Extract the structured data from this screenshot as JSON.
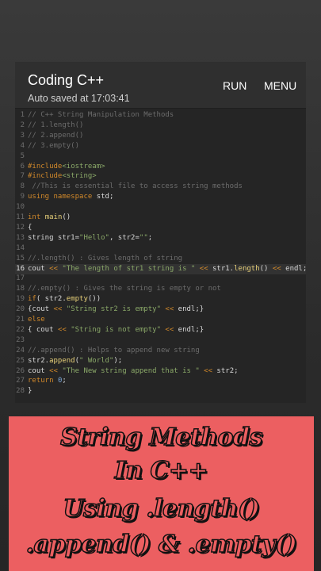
{
  "app": {
    "title": "Coding C++",
    "autosave": "Auto saved at 17:03:41",
    "run_label": "RUN",
    "menu_label": "MENU"
  },
  "editor": {
    "active_line": 16,
    "lines": [
      {
        "n": "1",
        "t": [
          [
            "cm",
            "// C++ String Manipulation Methods"
          ]
        ]
      },
      {
        "n": "2",
        "t": [
          [
            "cm",
            "// 1.length()"
          ]
        ]
      },
      {
        "n": "3",
        "t": [
          [
            "cm",
            "// 2.append()"
          ]
        ]
      },
      {
        "n": "4",
        "t": [
          [
            "cm",
            "// 3.empty()"
          ]
        ]
      },
      {
        "n": "5",
        "t": []
      },
      {
        "n": "6",
        "t": [
          [
            "pp",
            "#include"
          ],
          [
            "st",
            "<iostream>"
          ]
        ]
      },
      {
        "n": "7",
        "t": [
          [
            "pp",
            "#include"
          ],
          [
            "st",
            "<string>"
          ]
        ]
      },
      {
        "n": "8",
        "t": [
          [
            "cm",
            " //This is essential file to access string methods"
          ]
        ]
      },
      {
        "n": "9",
        "t": [
          [
            "kw",
            "using namespace"
          ],
          [
            "tx",
            " std;"
          ]
        ]
      },
      {
        "n": "10",
        "t": []
      },
      {
        "n": "11",
        "t": [
          [
            "kw",
            "int"
          ],
          [
            "tx",
            " "
          ],
          [
            "fn",
            "main"
          ],
          [
            "tx",
            "()"
          ]
        ]
      },
      {
        "n": "12",
        "t": [
          [
            "tx",
            "{"
          ]
        ]
      },
      {
        "n": "13",
        "t": [
          [
            "tx",
            "string str1="
          ],
          [
            "st",
            "\"Hello\""
          ],
          [
            "tx",
            ", str2="
          ],
          [
            "st",
            "\"\""
          ],
          [
            "tx",
            ";"
          ]
        ]
      },
      {
        "n": "14",
        "t": []
      },
      {
        "n": "15",
        "t": [
          [
            "cm",
            "//.length() : Gives length of string"
          ]
        ]
      },
      {
        "n": "16",
        "t": [
          [
            "tx",
            "cout "
          ],
          [
            "op",
            "<<"
          ],
          [
            "st",
            " \"The length of str1 string is \" "
          ],
          [
            "op",
            "<<"
          ],
          [
            "tx",
            " str1."
          ],
          [
            "fn",
            "length"
          ],
          [
            "tx",
            "() "
          ],
          [
            "op",
            "<<"
          ],
          [
            "tx",
            " endl;"
          ]
        ]
      },
      {
        "n": "17",
        "t": []
      },
      {
        "n": "18",
        "t": [
          [
            "cm",
            "//.empty() : Gives the string is empty or not"
          ]
        ]
      },
      {
        "n": "19",
        "t": [
          [
            "kw",
            "if"
          ],
          [
            "tx",
            "( str2."
          ],
          [
            "fn",
            "empty"
          ],
          [
            "tx",
            "())"
          ]
        ]
      },
      {
        "n": "20",
        "t": [
          [
            "tx",
            "{cout "
          ],
          [
            "op",
            "<<"
          ],
          [
            "st",
            " \"String str2 is empty\" "
          ],
          [
            "op",
            "<<"
          ],
          [
            "tx",
            " endl;}"
          ]
        ]
      },
      {
        "n": "21",
        "t": [
          [
            "kw",
            "else"
          ]
        ]
      },
      {
        "n": "22",
        "t": [
          [
            "tx",
            "{ cout "
          ],
          [
            "op",
            "<<"
          ],
          [
            "st",
            " \"String is not empty\" "
          ],
          [
            "op",
            "<<"
          ],
          [
            "tx",
            " endl;}"
          ]
        ]
      },
      {
        "n": "23",
        "t": []
      },
      {
        "n": "24",
        "t": [
          [
            "cm",
            "//.append() : Helps to append new string"
          ]
        ]
      },
      {
        "n": "25",
        "t": [
          [
            "tx",
            "str2."
          ],
          [
            "fn",
            "append"
          ],
          [
            "tx",
            "("
          ],
          [
            "st",
            "\" World\""
          ],
          [
            "tx",
            ");"
          ]
        ]
      },
      {
        "n": "26",
        "t": [
          [
            "tx",
            "cout "
          ],
          [
            "op",
            "<<"
          ],
          [
            "st",
            " \"The New string append that is \" "
          ],
          [
            "op",
            "<<"
          ],
          [
            "tx",
            " str2;"
          ]
        ]
      },
      {
        "n": "27",
        "t": [
          [
            "kw",
            "return"
          ],
          [
            "tx",
            " "
          ],
          [
            "nm",
            "0"
          ],
          [
            "tx",
            ";"
          ]
        ]
      },
      {
        "n": "28",
        "t": [
          [
            "tx",
            "}"
          ]
        ]
      }
    ]
  },
  "banner": {
    "line1": "String Methods",
    "line2": "In C++",
    "line3": "Using .length()",
    "line4": ".append() & .empty()"
  }
}
